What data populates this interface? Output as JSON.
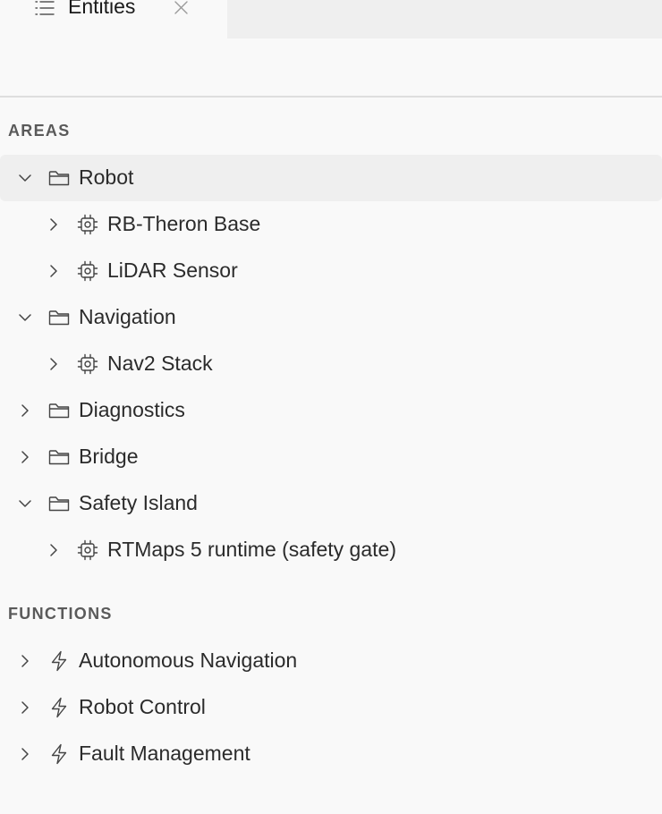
{
  "tab": {
    "label": "Entities",
    "list_icon": "list-icon",
    "close_icon": "close-icon"
  },
  "sections": {
    "areas_title": "AREAS",
    "functions_title": "FUNCTIONS"
  },
  "tree": {
    "areas": [
      {
        "label": "Robot",
        "type": "area",
        "expanded": true,
        "selected": true,
        "icon": "folder-icon"
      },
      {
        "label": "RB-Theron Base",
        "type": "component",
        "expanded": false,
        "icon": "chip-icon"
      },
      {
        "label": "LiDAR Sensor",
        "type": "component",
        "expanded": false,
        "icon": "chip-icon"
      },
      {
        "label": "Navigation",
        "type": "area",
        "expanded": true,
        "icon": "folder-icon"
      },
      {
        "label": "Nav2 Stack",
        "type": "component",
        "expanded": false,
        "icon": "chip-icon"
      },
      {
        "label": "Diagnostics",
        "type": "area",
        "expanded": false,
        "icon": "folder-icon"
      },
      {
        "label": "Bridge",
        "type": "area",
        "expanded": false,
        "icon": "folder-icon"
      },
      {
        "label": "Safety Island",
        "type": "area",
        "expanded": true,
        "icon": "folder-icon"
      },
      {
        "label": "RTMaps 5 runtime (safety gate)",
        "type": "component",
        "expanded": false,
        "icon": "chip-icon"
      }
    ],
    "functions": [
      {
        "label": "Autonomous Navigation",
        "expanded": false,
        "icon": "lightning-icon"
      },
      {
        "label": "Robot Control",
        "expanded": false,
        "icon": "lightning-icon"
      },
      {
        "label": "Fault Management",
        "expanded": false,
        "icon": "lightning-icon"
      }
    ]
  }
}
